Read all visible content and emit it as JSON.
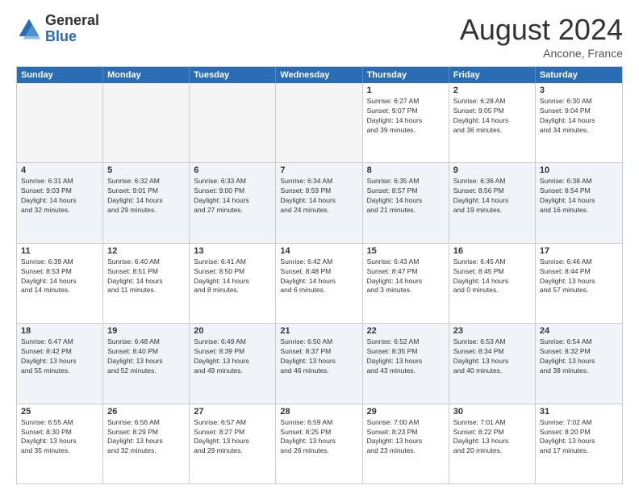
{
  "logo": {
    "general": "General",
    "blue": "Blue"
  },
  "header": {
    "month": "August 2024",
    "location": "Ancone, France"
  },
  "days": [
    "Sunday",
    "Monday",
    "Tuesday",
    "Wednesday",
    "Thursday",
    "Friday",
    "Saturday"
  ],
  "rows": [
    [
      {
        "day": "",
        "text": "",
        "empty": true
      },
      {
        "day": "",
        "text": "",
        "empty": true
      },
      {
        "day": "",
        "text": "",
        "empty": true
      },
      {
        "day": "",
        "text": "",
        "empty": true
      },
      {
        "day": "1",
        "text": "Sunrise: 6:27 AM\nSunset: 9:07 PM\nDaylight: 14 hours\nand 39 minutes."
      },
      {
        "day": "2",
        "text": "Sunrise: 6:28 AM\nSunset: 9:05 PM\nDaylight: 14 hours\nand 36 minutes."
      },
      {
        "day": "3",
        "text": "Sunrise: 6:30 AM\nSunset: 9:04 PM\nDaylight: 14 hours\nand 34 minutes."
      }
    ],
    [
      {
        "day": "4",
        "text": "Sunrise: 6:31 AM\nSunset: 9:03 PM\nDaylight: 14 hours\nand 32 minutes."
      },
      {
        "day": "5",
        "text": "Sunrise: 6:32 AM\nSunset: 9:01 PM\nDaylight: 14 hours\nand 29 minutes."
      },
      {
        "day": "6",
        "text": "Sunrise: 6:33 AM\nSunset: 9:00 PM\nDaylight: 14 hours\nand 27 minutes."
      },
      {
        "day": "7",
        "text": "Sunrise: 6:34 AM\nSunset: 8:59 PM\nDaylight: 14 hours\nand 24 minutes."
      },
      {
        "day": "8",
        "text": "Sunrise: 6:35 AM\nSunset: 8:57 PM\nDaylight: 14 hours\nand 21 minutes."
      },
      {
        "day": "9",
        "text": "Sunrise: 6:36 AM\nSunset: 8:56 PM\nDaylight: 14 hours\nand 19 minutes."
      },
      {
        "day": "10",
        "text": "Sunrise: 6:38 AM\nSunset: 8:54 PM\nDaylight: 14 hours\nand 16 minutes."
      }
    ],
    [
      {
        "day": "11",
        "text": "Sunrise: 6:39 AM\nSunset: 8:53 PM\nDaylight: 14 hours\nand 14 minutes."
      },
      {
        "day": "12",
        "text": "Sunrise: 6:40 AM\nSunset: 8:51 PM\nDaylight: 14 hours\nand 11 minutes."
      },
      {
        "day": "13",
        "text": "Sunrise: 6:41 AM\nSunset: 8:50 PM\nDaylight: 14 hours\nand 8 minutes."
      },
      {
        "day": "14",
        "text": "Sunrise: 6:42 AM\nSunset: 8:48 PM\nDaylight: 14 hours\nand 6 minutes."
      },
      {
        "day": "15",
        "text": "Sunrise: 6:43 AM\nSunset: 8:47 PM\nDaylight: 14 hours\nand 3 minutes."
      },
      {
        "day": "16",
        "text": "Sunrise: 6:45 AM\nSunset: 8:45 PM\nDaylight: 14 hours\nand 0 minutes."
      },
      {
        "day": "17",
        "text": "Sunrise: 6:46 AM\nSunset: 8:44 PM\nDaylight: 13 hours\nand 57 minutes."
      }
    ],
    [
      {
        "day": "18",
        "text": "Sunrise: 6:47 AM\nSunset: 8:42 PM\nDaylight: 13 hours\nand 55 minutes."
      },
      {
        "day": "19",
        "text": "Sunrise: 6:48 AM\nSunset: 8:40 PM\nDaylight: 13 hours\nand 52 minutes."
      },
      {
        "day": "20",
        "text": "Sunrise: 6:49 AM\nSunset: 8:39 PM\nDaylight: 13 hours\nand 49 minutes."
      },
      {
        "day": "21",
        "text": "Sunrise: 6:50 AM\nSunset: 8:37 PM\nDaylight: 13 hours\nand 46 minutes."
      },
      {
        "day": "22",
        "text": "Sunrise: 6:52 AM\nSunset: 8:35 PM\nDaylight: 13 hours\nand 43 minutes."
      },
      {
        "day": "23",
        "text": "Sunrise: 6:53 AM\nSunset: 8:34 PM\nDaylight: 13 hours\nand 40 minutes."
      },
      {
        "day": "24",
        "text": "Sunrise: 6:54 AM\nSunset: 8:32 PM\nDaylight: 13 hours\nand 38 minutes."
      }
    ],
    [
      {
        "day": "25",
        "text": "Sunrise: 6:55 AM\nSunset: 8:30 PM\nDaylight: 13 hours\nand 35 minutes."
      },
      {
        "day": "26",
        "text": "Sunrise: 6:56 AM\nSunset: 8:29 PM\nDaylight: 13 hours\nand 32 minutes."
      },
      {
        "day": "27",
        "text": "Sunrise: 6:57 AM\nSunset: 8:27 PM\nDaylight: 13 hours\nand 29 minutes."
      },
      {
        "day": "28",
        "text": "Sunrise: 6:59 AM\nSunset: 8:25 PM\nDaylight: 13 hours\nand 26 minutes."
      },
      {
        "day": "29",
        "text": "Sunrise: 7:00 AM\nSunset: 8:23 PM\nDaylight: 13 hours\nand 23 minutes."
      },
      {
        "day": "30",
        "text": "Sunrise: 7:01 AM\nSunset: 8:22 PM\nDaylight: 13 hours\nand 20 minutes."
      },
      {
        "day": "31",
        "text": "Sunrise: 7:02 AM\nSunset: 8:20 PM\nDaylight: 13 hours\nand 17 minutes."
      }
    ]
  ]
}
